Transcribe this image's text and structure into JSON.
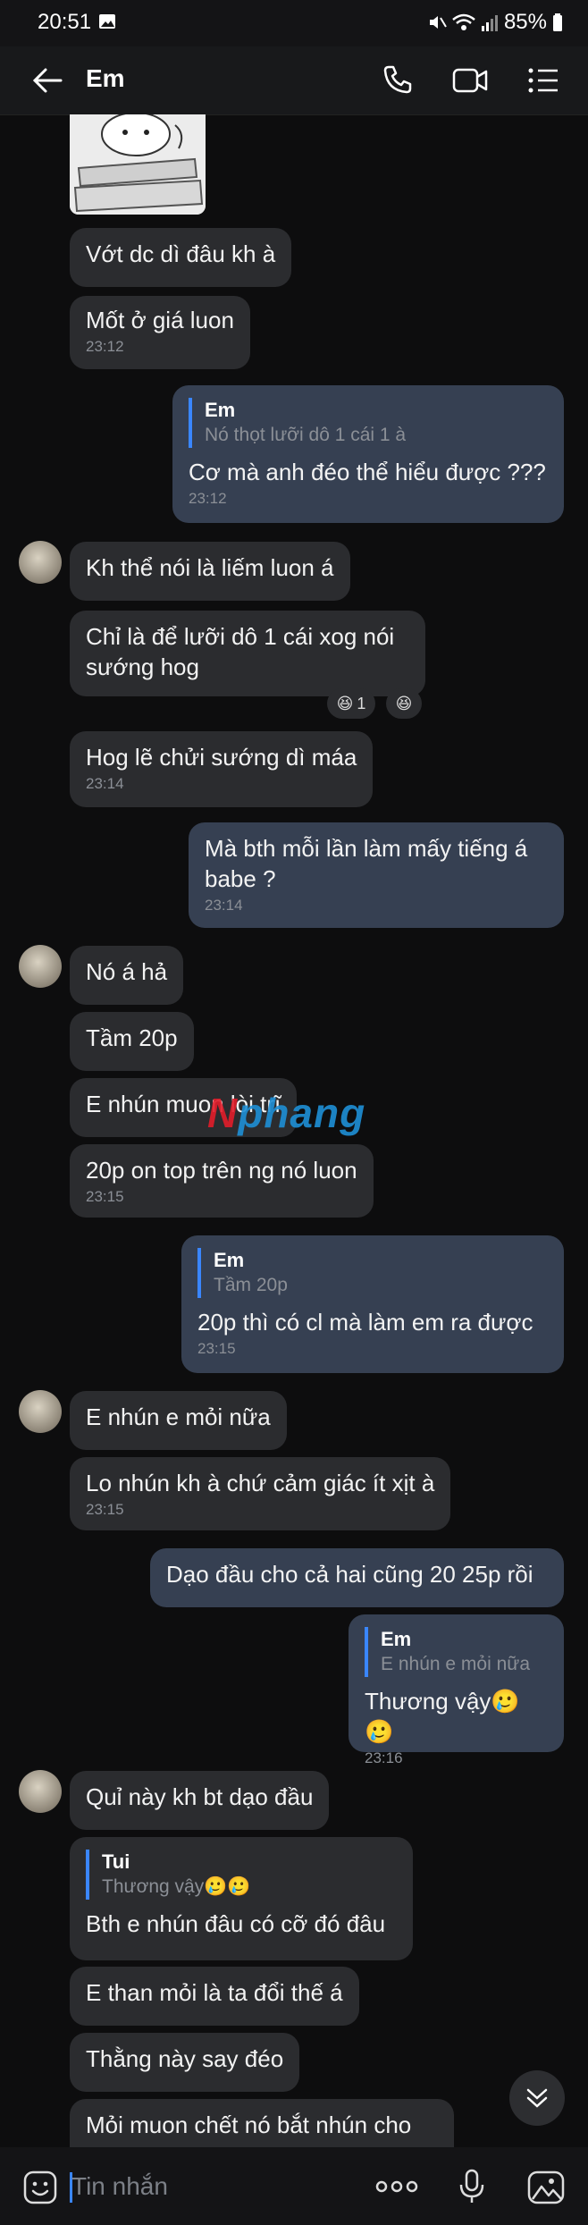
{
  "status_bar": {
    "time": "20:51",
    "battery": "85%"
  },
  "header": {
    "contact_name": "Em"
  },
  "watermark": {
    "part1": "N",
    "part2": "phang"
  },
  "input": {
    "placeholder": "Tin nhắn"
  },
  "messages": [
    {
      "text": "Vớt dc dì đâu kh à"
    },
    {
      "text": "Mốt ở giá luon",
      "time": "23:12"
    },
    {
      "quote_name": "Em",
      "quote_text": "Nó thọt lưỡi dô 1 cái 1 à",
      "text": "Cơ mà anh đéo thể hiểu được ???",
      "time": "23:12"
    },
    {
      "text": "Kh thể nói là liếm luon á"
    },
    {
      "text": "Chỉ là để lưỡi dô 1 cái xog nói sướng hog",
      "reaction_count": "1"
    },
    {
      "text": "Hog lẽ chửi sướng dì máa",
      "time": "23:14"
    },
    {
      "text": "Mà bth mỗi lần làm mấy tiếng á babe ?",
      "time": "23:14"
    },
    {
      "text": "Nó á hả"
    },
    {
      "text": "Tầm 20p"
    },
    {
      "text": "E nhún muon lòi trĩ"
    },
    {
      "text": "20p on top trên ng nó luon",
      "time": "23:15"
    },
    {
      "quote_name": "Em",
      "quote_text": "Tầm 20p",
      "text": "20p thì có cl mà làm em ra được",
      "time": "23:15"
    },
    {
      "text": "E nhún e mỏi nữa"
    },
    {
      "text": "Lo nhún kh à chứ cảm giác ít xịt à",
      "time": "23:15"
    },
    {
      "text": "Dạo đầu cho cả hai cũng 20 25p rồi"
    },
    {
      "quote_name": "Em",
      "quote_text": "E nhún e mỏi nữa",
      "text": "Thương vậy🥲🥲",
      "time": "23:16"
    },
    {
      "text": "Quỉ này kh bt dạo đầu"
    },
    {
      "quote_name": "Tui",
      "quote_text": "Thương vậy🥲🥲",
      "text": "Bth e nhún đâu có cỡ đó đâu"
    },
    {
      "text": "E than mỏi là ta đổi thế á"
    },
    {
      "text": "Thằng này say đéo"
    },
    {
      "text": "Mỏi muon chết nó bắt nhún cho"
    }
  ]
}
